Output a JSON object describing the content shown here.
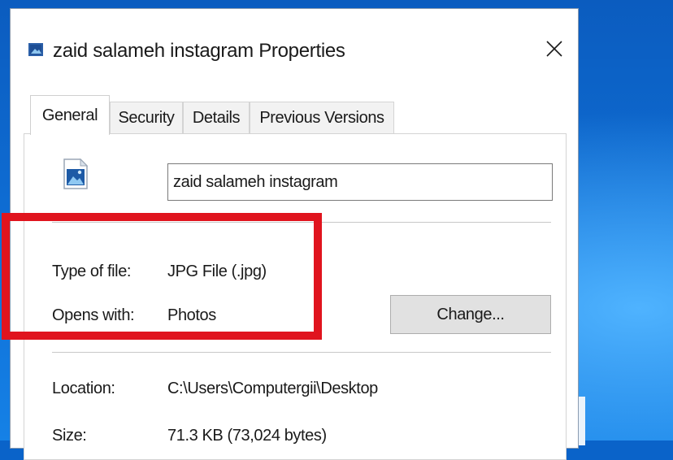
{
  "window": {
    "title": "zaid salameh instagram Properties",
    "close_symbol": "✕"
  },
  "tabs": [
    {
      "label": "General",
      "active": true
    },
    {
      "label": "Security",
      "active": false
    },
    {
      "label": "Details",
      "active": false
    },
    {
      "label": "Previous Versions",
      "active": false
    }
  ],
  "general": {
    "file_name": "zaid salameh instagram",
    "type_label": "Type of file:",
    "type_value": "JPG File (.jpg)",
    "opens_label": "Opens with:",
    "opens_value": "Photos",
    "change_button": "Change...",
    "location_label": "Location:",
    "location_value": "C:\\Users\\Computergii\\Desktop",
    "size_label": "Size:",
    "size_value": "71.3 KB (73,024 bytes)"
  },
  "icons": {
    "title_icon": "image-file-icon",
    "file_icon": "image-file-icon",
    "close_icon": "close-icon"
  },
  "colors": {
    "highlight": "#e0141e",
    "desktop": "#0b5cbf"
  }
}
